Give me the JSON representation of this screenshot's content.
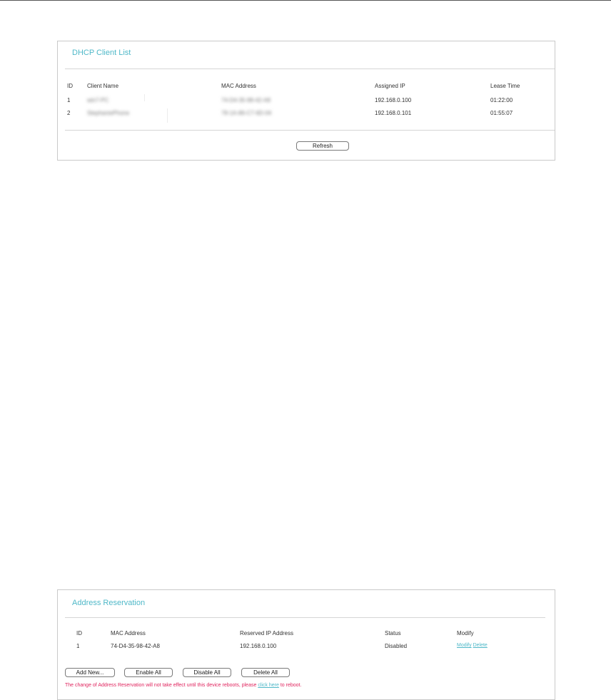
{
  "dhcp": {
    "title": "DHCP Client List",
    "columns": [
      "ID",
      "Client Name",
      "MAC Address",
      "Assigned IP",
      "Lease Time"
    ],
    "rows": [
      {
        "id": "1",
        "client_name": "win7-PC",
        "mac": "74-D4-35-98-42-A8",
        "ip": "192.168.0.100",
        "lease": "01:22:00"
      },
      {
        "id": "2",
        "client_name": "StephaniePhone",
        "mac": "78-1A-86-C7-6D-04",
        "ip": "192.168.0.101",
        "lease": "01:55:07"
      }
    ],
    "refresh_label": "Refresh"
  },
  "reservation": {
    "title": "Address Reservation",
    "columns": [
      "ID",
      "MAC Address",
      "Reserved IP Address",
      "Status",
      "Modify"
    ],
    "rows": [
      {
        "id": "1",
        "mac": "74-D4-35-98-42-A8",
        "ip": "192.168.0.100",
        "status": "Disabled",
        "modify": "Modify",
        "delete": "Delete"
      }
    ],
    "buttons": {
      "add_new": "Add New...",
      "enable_all": "Enable All",
      "disable_all": "Disable All",
      "delete_all": "Delete All"
    },
    "notice": {
      "before": "The change of Address Reservation will not take effect until this device reboots, please ",
      "link": "click here",
      "after": " to reboot."
    }
  },
  "colors": {
    "accent": "#4fb8c8",
    "warning": "#e0245e",
    "border": "#c9c9c9"
  }
}
